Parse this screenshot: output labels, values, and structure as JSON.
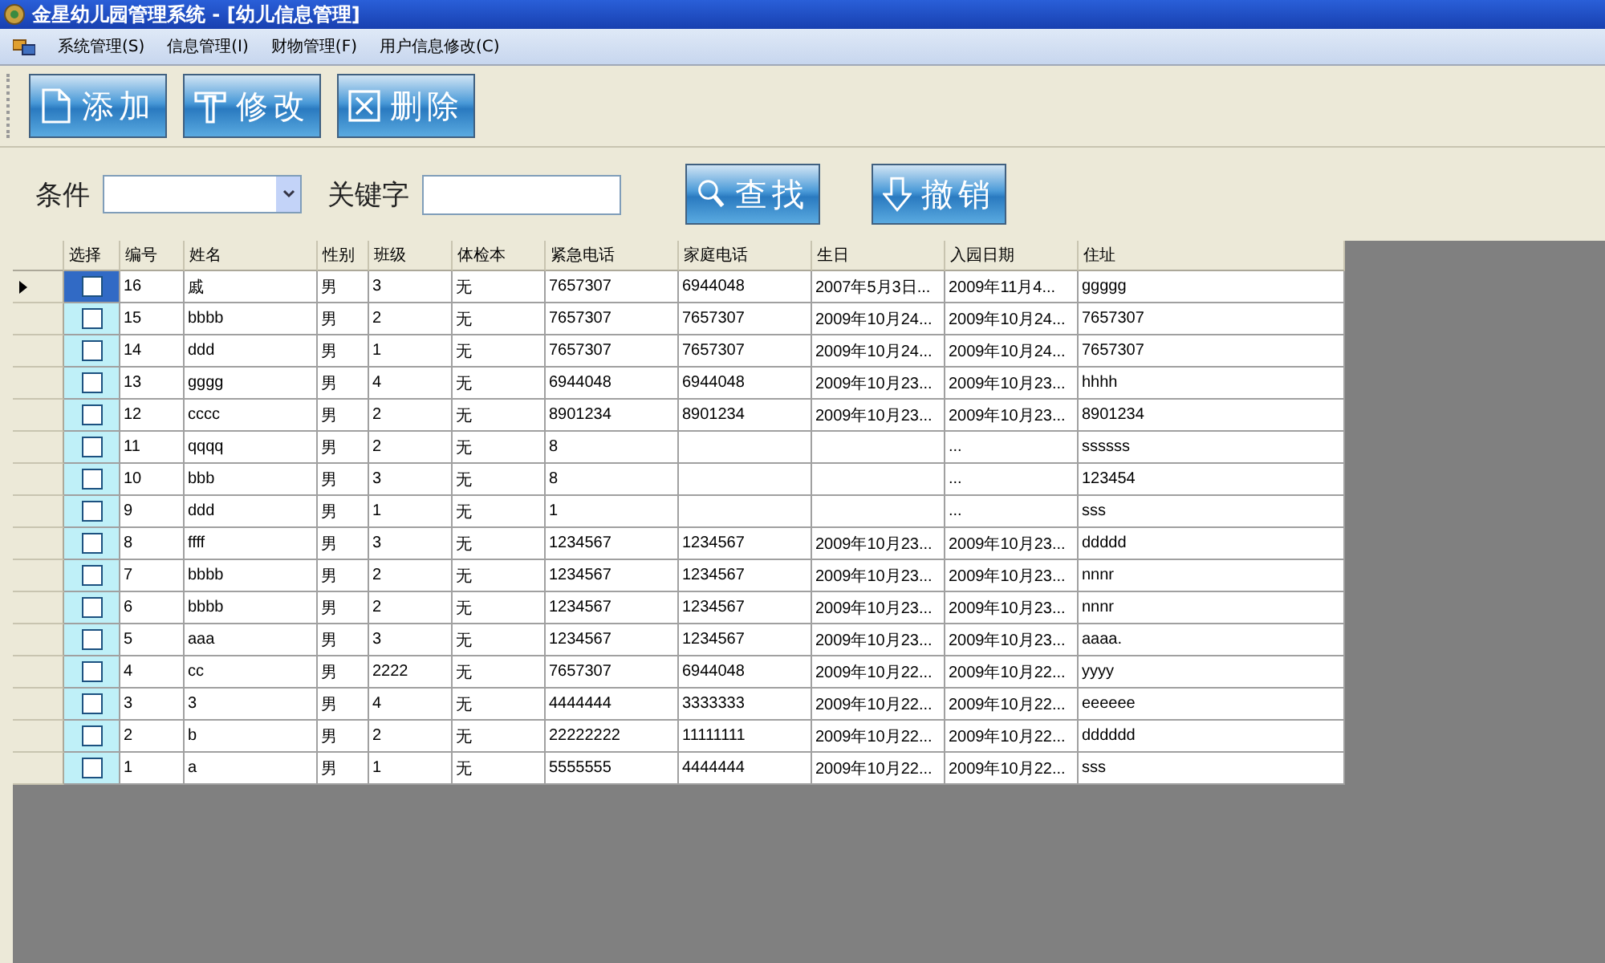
{
  "window": {
    "title": "金星幼儿园管理系统 - [幼儿信息管理]"
  },
  "menu": [
    "系统管理(S)",
    "信息管理(I)",
    "财物管理(F)",
    "用户信息修改(C)"
  ],
  "toolbar": [
    {
      "label": "添加",
      "kind": "add"
    },
    {
      "label": "修改",
      "kind": "edit"
    },
    {
      "label": "删除",
      "kind": "delete"
    }
  ],
  "search": {
    "condition_label": "条件",
    "keyword_label": "关键字",
    "buttons": [
      {
        "label": "查找",
        "kind": "find"
      },
      {
        "label": "撤销",
        "kind": "undo"
      }
    ]
  },
  "table": {
    "checkbox_column": "选择",
    "columns": [
      "编号",
      "姓名",
      "性别",
      "班级",
      "体检本",
      "紧急电话",
      "家庭电话",
      "生日",
      "入园日期",
      "住址"
    ],
    "rows": [
      {
        "selected": true,
        "checked": false,
        "cells": [
          "16",
          "戚",
          "男",
          "3",
          "无",
          "7657307",
          "6944048",
          "2007年5月3日...",
          "2009年11月4...",
          "ggggg"
        ]
      },
      {
        "selected": false,
        "checked": false,
        "cells": [
          "15",
          "bbbb",
          "男",
          "2",
          "无",
          "7657307",
          "7657307",
          "2009年10月24...",
          "2009年10月24...",
          "7657307"
        ]
      },
      {
        "selected": false,
        "checked": false,
        "cells": [
          "14",
          "ddd",
          "男",
          "1",
          "无",
          "7657307",
          "7657307",
          "2009年10月24...",
          "2009年10月24...",
          "7657307"
        ]
      },
      {
        "selected": false,
        "checked": false,
        "cells": [
          "13",
          "gggg",
          "男",
          "4",
          "无",
          "6944048",
          "6944048",
          "2009年10月23...",
          "2009年10月23...",
          "hhhh"
        ]
      },
      {
        "selected": false,
        "checked": false,
        "cells": [
          "12",
          "cccc",
          "男",
          "2",
          "无",
          "8901234",
          "8901234",
          "2009年10月23...",
          "2009年10月23...",
          "8901234"
        ]
      },
      {
        "selected": false,
        "checked": false,
        "cells": [
          "11",
          "qqqq",
          "男",
          "2",
          "无",
          "8",
          null,
          null,
          "...",
          "ssssss"
        ]
      },
      {
        "selected": false,
        "checked": false,
        "cells": [
          "10",
          "bbb",
          "男",
          "3",
          "无",
          "8",
          null,
          null,
          "...",
          "123454"
        ]
      },
      {
        "selected": false,
        "checked": false,
        "cells": [
          "9",
          "ddd",
          "男",
          "1",
          "无",
          "1",
          null,
          null,
          "...",
          "sss"
        ]
      },
      {
        "selected": false,
        "checked": false,
        "cells": [
          "8",
          "ffff",
          "男",
          "3",
          "无",
          "1234567",
          "1234567",
          "2009年10月23...",
          "2009年10月23...",
          "ddddd"
        ]
      },
      {
        "selected": false,
        "checked": false,
        "cells": [
          "7",
          "bbbb",
          "男",
          "2",
          "无",
          "1234567",
          "1234567",
          "2009年10月23...",
          "2009年10月23...",
          "nnnr"
        ]
      },
      {
        "selected": false,
        "checked": false,
        "cells": [
          "6",
          "bbbb",
          "男",
          "2",
          "无",
          "1234567",
          "1234567",
          "2009年10月23...",
          "2009年10月23...",
          "nnnr"
        ]
      },
      {
        "selected": false,
        "checked": false,
        "cells": [
          "5",
          "aaa",
          "男",
          "3",
          "无",
          "1234567",
          "1234567",
          "2009年10月23...",
          "2009年10月23...",
          "aaaa."
        ]
      },
      {
        "selected": false,
        "checked": false,
        "cells": [
          "4",
          "cc",
          "男",
          "2222",
          "无",
          "7657307",
          "6944048",
          "2009年10月22...",
          "2009年10月22...",
          "yyyy"
        ]
      },
      {
        "selected": false,
        "checked": false,
        "cells": [
          "3",
          "3",
          "男",
          "4",
          "无",
          "4444444",
          "3333333",
          "2009年10月22...",
          "2009年10月22...",
          "eeeeee"
        ]
      },
      {
        "selected": false,
        "checked": false,
        "cells": [
          "2",
          "b",
          "男",
          "2",
          "无",
          "22222222",
          "11111111",
          "2009年10月22...",
          "2009年10月22...",
          "dddddd"
        ]
      },
      {
        "selected": false,
        "checked": false,
        "cells": [
          "1",
          "a",
          "男",
          "1",
          "无",
          "5555555",
          "4444444",
          "2009年10月22...",
          "2009年10月22...",
          "sss"
        ]
      }
    ]
  }
}
